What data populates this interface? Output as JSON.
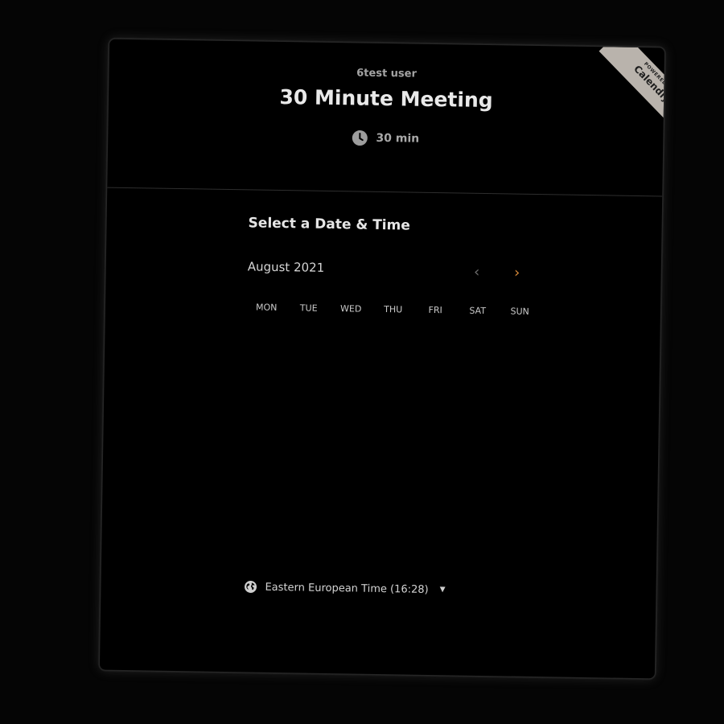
{
  "header": {
    "organizer": "6test user",
    "event_title": "30 Minute Meeting",
    "duration": "30 min",
    "duration_icon": "clock-icon"
  },
  "badge": {
    "small_text": "POWERED BY",
    "brand": "Calendly"
  },
  "calendar": {
    "section_title": "Select a Date & Time",
    "month_label": "August 2021",
    "prev_icon": "chevron-left-icon",
    "next_icon": "chevron-right-icon",
    "weekdays": [
      "MON",
      "TUE",
      "WED",
      "THU",
      "FRI",
      "SAT",
      "SUN"
    ]
  },
  "timezone": {
    "label": "Eastern European Time (16:28)",
    "icon": "globe-icon"
  },
  "colors": {
    "background": "#000000",
    "accent": "#d98b3a",
    "badge": "#b9b3ac"
  }
}
